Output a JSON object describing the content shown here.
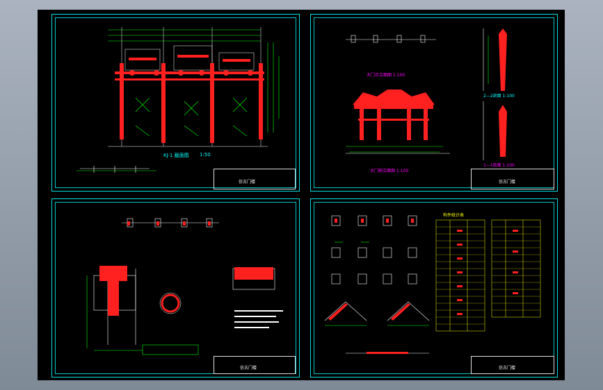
{
  "colors": {
    "frame": "#00e0e0",
    "structure": "#ff2020",
    "dims": "#00ff00",
    "lines": "#ffffff",
    "title": "#ff00ff",
    "table": "#ffff00"
  },
  "sheet1": {
    "view_title": "KJ-1 截面图",
    "scale": "1:50",
    "tb_name": "仿古门楼"
  },
  "sheet2": {
    "view_title_front": "大门正立面图 1:100",
    "view_title_side": "2—2剖面 1:100",
    "view_title_bottom": "大门侧立面图 1:100",
    "view_title_section": "1—1剖面 1:100",
    "tb_name": "仿古门楼"
  },
  "sheet3": {
    "tb_name": "仿古门楼"
  },
  "sheet4": {
    "tb_name": "仿古门楼",
    "table_title": "构件统计表"
  }
}
